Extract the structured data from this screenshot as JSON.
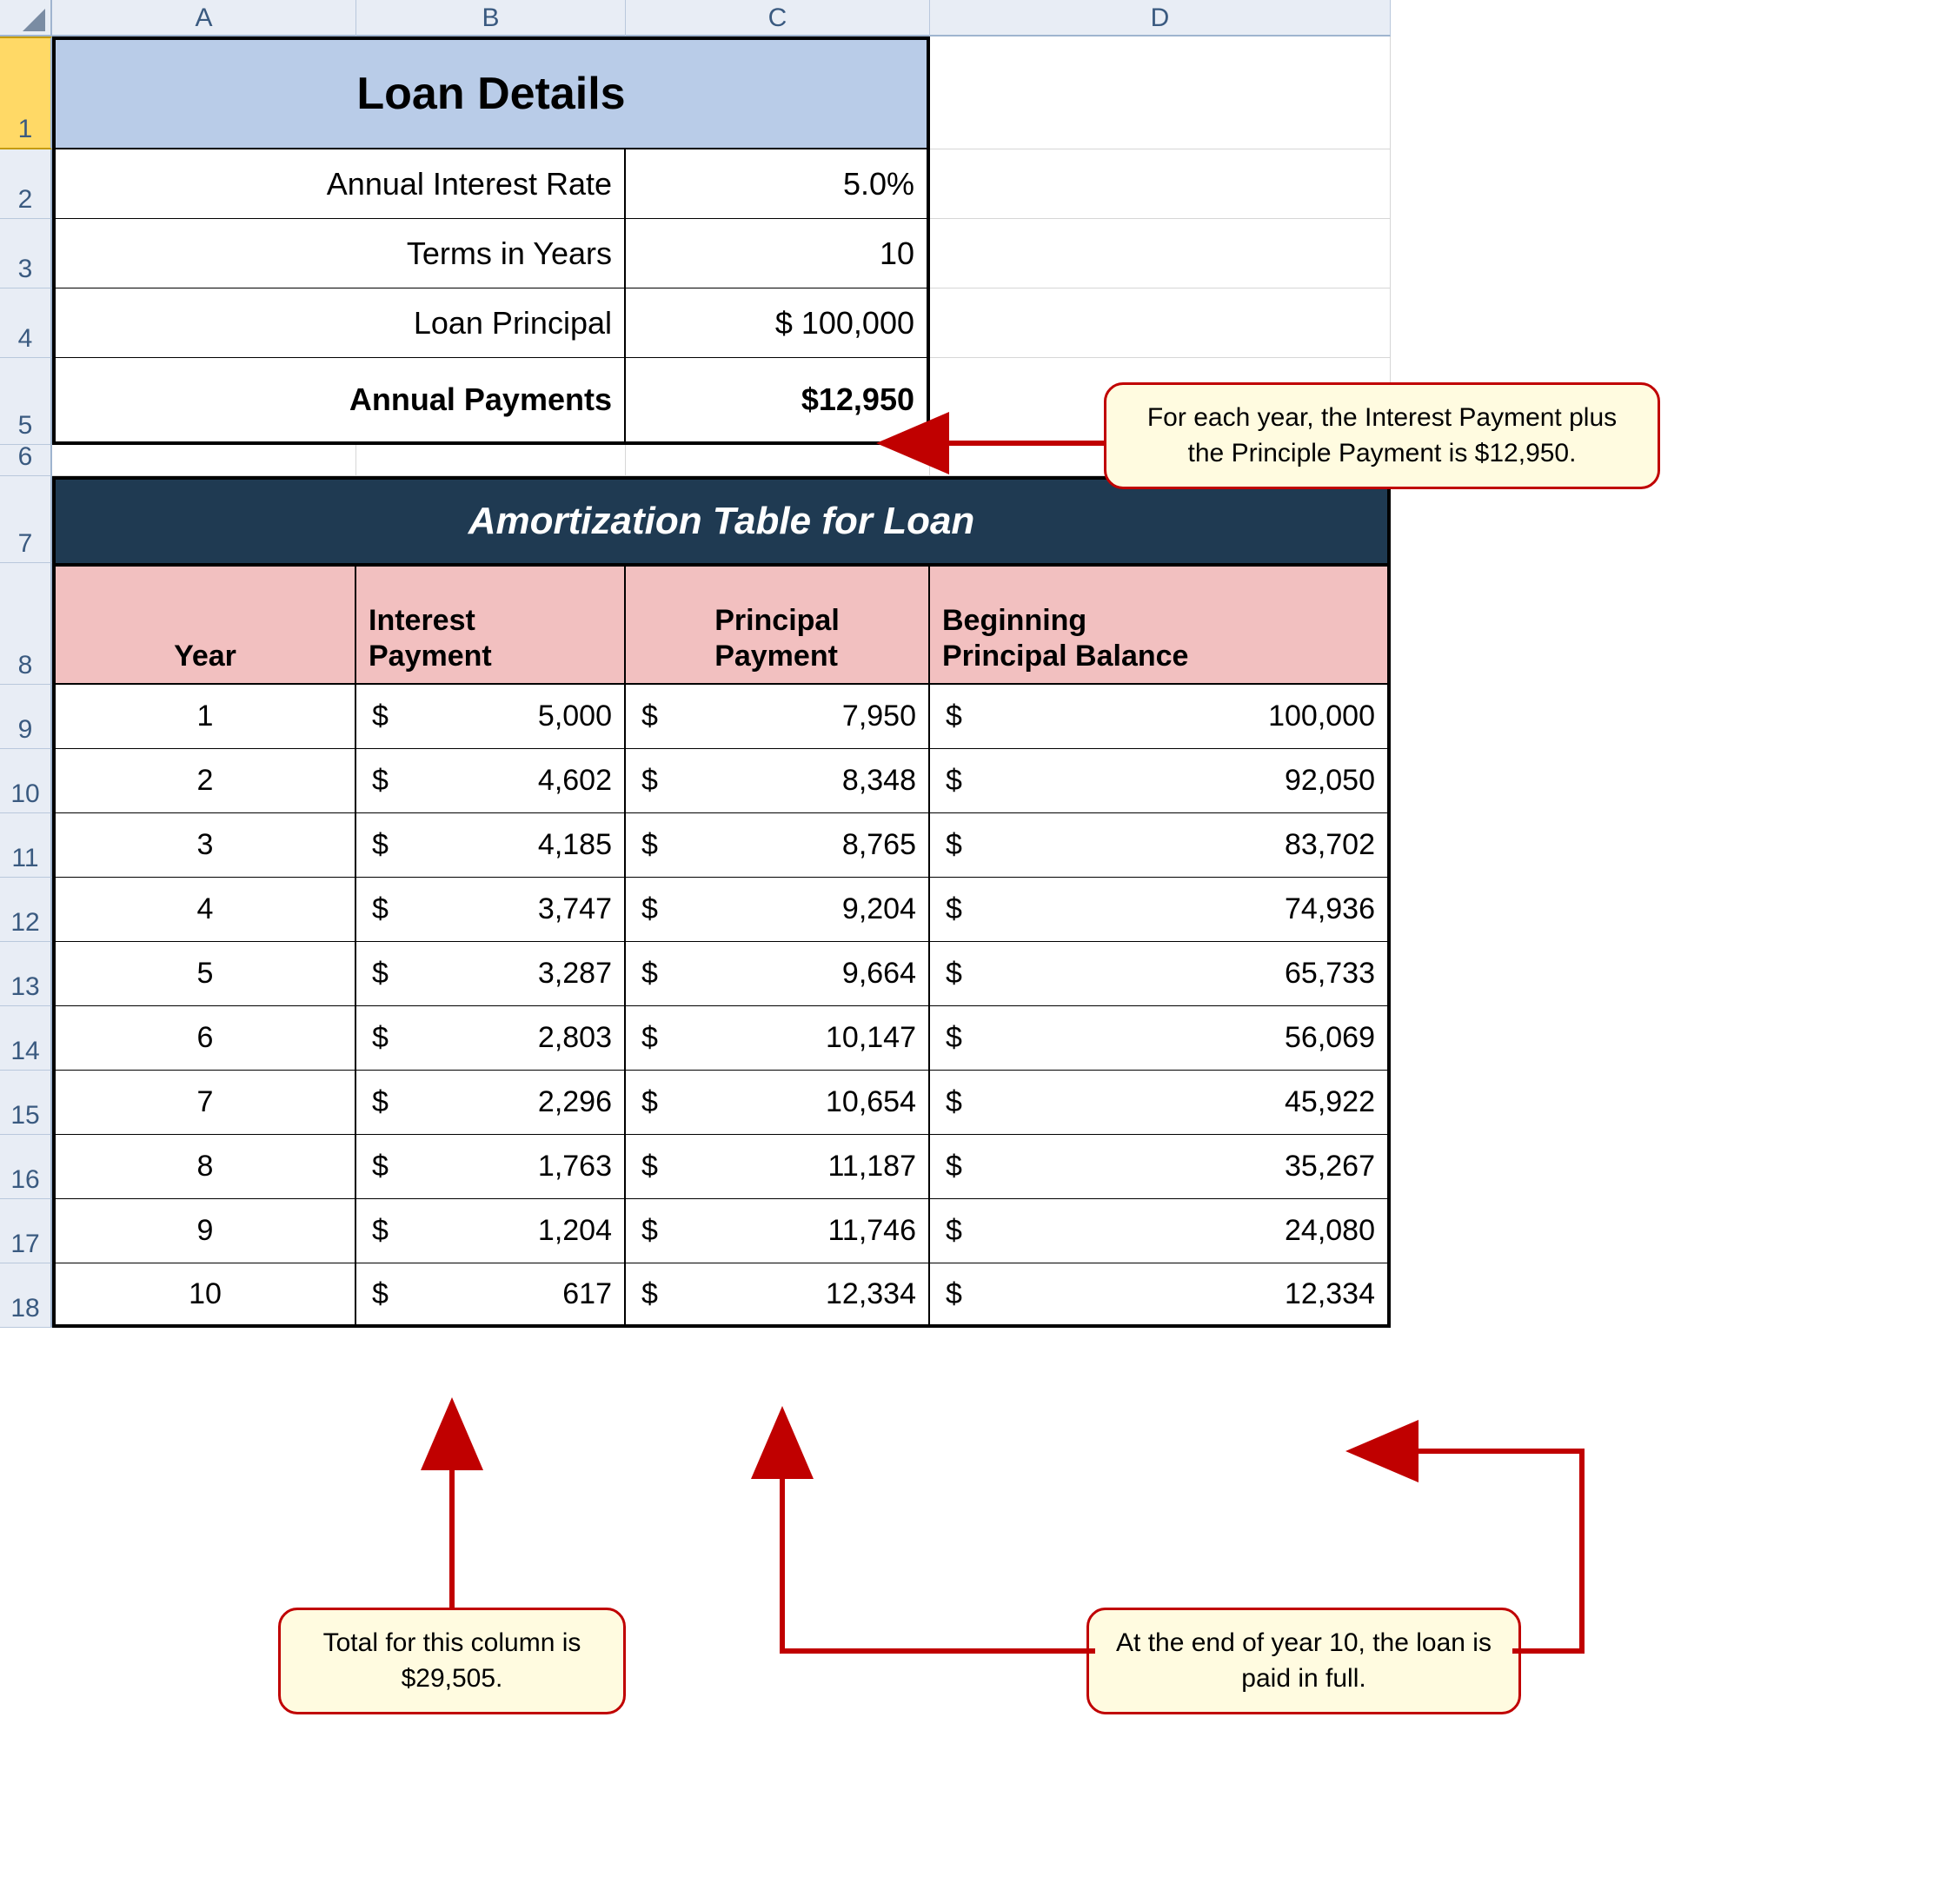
{
  "columns": [
    "A",
    "B",
    "C",
    "D"
  ],
  "rows": [
    "1",
    "2",
    "3",
    "4",
    "5",
    "6",
    "7",
    "8",
    "9",
    "10",
    "11",
    "12",
    "13",
    "14",
    "15",
    "16",
    "17",
    "18"
  ],
  "loanDetails": {
    "title": "Loan Details",
    "labels": {
      "rate": "Annual Interest Rate",
      "terms": "Terms in Years",
      "principal": "Loan Principal",
      "payments": "Annual Payments"
    },
    "values": {
      "rate": "5.0%",
      "terms": "10",
      "principal": "$ 100,000",
      "payments": "$12,950"
    }
  },
  "amort": {
    "title": "Amortization Table for Loan",
    "headers": {
      "year": "Year",
      "interest": "Interest\nPayment",
      "principal": "Principal\nPayment",
      "balance": "Beginning\nPrincipal Balance"
    },
    "rows": [
      {
        "year": "1",
        "interest": "5,000",
        "principal": "7,950",
        "balance": "100,000"
      },
      {
        "year": "2",
        "interest": "4,602",
        "principal": "8,348",
        "balance": "92,050"
      },
      {
        "year": "3",
        "interest": "4,185",
        "principal": "8,765",
        "balance": "83,702"
      },
      {
        "year": "4",
        "interest": "3,747",
        "principal": "9,204",
        "balance": "74,936"
      },
      {
        "year": "5",
        "interest": "3,287",
        "principal": "9,664",
        "balance": "65,733"
      },
      {
        "year": "6",
        "interest": "2,803",
        "principal": "10,147",
        "balance": "56,069"
      },
      {
        "year": "7",
        "interest": "2,296",
        "principal": "10,654",
        "balance": "45,922"
      },
      {
        "year": "8",
        "interest": "1,763",
        "principal": "11,187",
        "balance": "35,267"
      },
      {
        "year": "9",
        "interest": "1,204",
        "principal": "11,746",
        "balance": "24,080"
      },
      {
        "year": "10",
        "interest": "617",
        "principal": "12,334",
        "balance": "12,334"
      }
    ]
  },
  "callouts": {
    "c1": "For each year, the Interest Payment plus the Principle Payment is $12,950.",
    "c2": "Total for this column is $29,505.",
    "c3": "At the end of year 10, the loan is paid in full."
  },
  "chart_data": {
    "type": "table",
    "title": "Amortization Table for Loan",
    "loan": {
      "annual_interest_rate": 0.05,
      "terms_years": 10,
      "principal": 100000,
      "annual_payment": 12950
    },
    "columns": [
      "Year",
      "Interest Payment",
      "Principal Payment",
      "Beginning Principal Balance"
    ],
    "rows": [
      [
        1,
        5000,
        7950,
        100000
      ],
      [
        2,
        4602,
        8348,
        92050
      ],
      [
        3,
        4185,
        8765,
        83702
      ],
      [
        4,
        3747,
        9204,
        74936
      ],
      [
        5,
        3287,
        9664,
        65733
      ],
      [
        6,
        2803,
        10147,
        56069
      ],
      [
        7,
        2296,
        10654,
        45922
      ],
      [
        8,
        1763,
        11187,
        35267
      ],
      [
        9,
        1204,
        11746,
        24080
      ],
      [
        10,
        617,
        12334,
        12334
      ]
    ],
    "annotations": {
      "interest_column_total": 29505
    }
  }
}
